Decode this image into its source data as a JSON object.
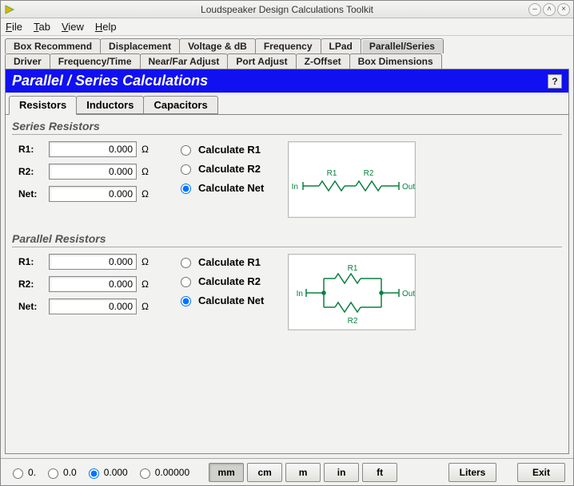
{
  "window": {
    "title": "Loudspeaker Design Calculations Toolkit"
  },
  "menu": {
    "file": "File",
    "tab": "Tab",
    "view": "View",
    "help": "Help"
  },
  "tabs": {
    "row1": [
      "Box Recommend",
      "Displacement",
      "Voltage & dB",
      "Frequency",
      "LPad",
      "Parallel/Series"
    ],
    "row2": [
      "Driver",
      "Frequency/Time",
      "Near/Far Adjust",
      "Port Adjust",
      "Z-Offset",
      "Box Dimensions"
    ],
    "active": "Parallel/Series"
  },
  "panel": {
    "title": "Parallel / Series Calculations",
    "help": "?"
  },
  "subtabs": {
    "items": [
      "Resistors",
      "Inductors",
      "Capacitors"
    ],
    "active": "Resistors"
  },
  "series": {
    "title": "Series Resistors",
    "r1": {
      "label": "R1:",
      "value": "0.000",
      "unit": "Ω"
    },
    "r2": {
      "label": "R2:",
      "value": "0.000",
      "unit": "Ω"
    },
    "net": {
      "label": "Net:",
      "value": "0.000",
      "unit": "Ω"
    },
    "calc_r1": "Calculate R1",
    "calc_r2": "Calculate R2",
    "calc_net": "Calculate Net",
    "selected": "net",
    "diagram": {
      "in": "In",
      "out": "Out",
      "r1": "R1",
      "r2": "R2"
    }
  },
  "parallel": {
    "title": "Parallel Resistors",
    "r1": {
      "label": "R1:",
      "value": "0.000",
      "unit": "Ω"
    },
    "r2": {
      "label": "R2:",
      "value": "0.000",
      "unit": "Ω"
    },
    "net": {
      "label": "Net:",
      "value": "0.000",
      "unit": "Ω"
    },
    "calc_r1": "Calculate R1",
    "calc_r2": "Calculate R2",
    "calc_net": "Calculate Net",
    "selected": "net",
    "diagram": {
      "in": "In",
      "out": "Out",
      "r1": "R1",
      "r2": "R2"
    }
  },
  "bottom": {
    "precision": {
      "p0": "0.",
      "p00": "0.0",
      "p000": "0.000",
      "p00000": "0.00000",
      "selected": "0.000"
    },
    "units": {
      "mm": "mm",
      "cm": "cm",
      "m": "m",
      "in": "in",
      "ft": "ft",
      "active": "mm"
    },
    "liters": "Liters",
    "exit": "Exit"
  }
}
